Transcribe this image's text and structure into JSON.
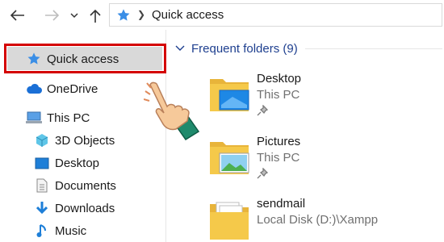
{
  "address_bar": {
    "back_icon": "back-arrow-icon",
    "forward_icon": "forward-arrow-icon",
    "recent_icon": "chevron-down-icon",
    "up_icon": "up-arrow-icon",
    "location_icon": "star-icon",
    "path": "Quick access"
  },
  "nav_pane": {
    "items": [
      {
        "label": "Quick access",
        "icon": "star-icon",
        "selected": true
      },
      {
        "label": "OneDrive",
        "icon": "cloud-icon"
      },
      {
        "label": "This PC",
        "icon": "computer-icon"
      },
      {
        "label": "3D Objects",
        "icon": "cube-icon"
      },
      {
        "label": "Desktop",
        "icon": "desktop-icon"
      },
      {
        "label": "Documents",
        "icon": "document-icon"
      },
      {
        "label": "Downloads",
        "icon": "download-icon"
      },
      {
        "label": "Music",
        "icon": "music-note-icon"
      }
    ]
  },
  "content": {
    "section_title": "Frequent folders (9)",
    "folders": [
      {
        "name": "Desktop",
        "location": "This PC",
        "pinned": true,
        "icon": "folder-desktop-icon"
      },
      {
        "name": "Pictures",
        "location": "This PC",
        "pinned": true,
        "icon": "folder-pictures-icon"
      },
      {
        "name": "sendmail",
        "location": "Local Disk (D:)\\Xampp",
        "pinned": false,
        "icon": "folder-icon"
      }
    ]
  },
  "colors": {
    "accent_blue": "#1e3f8f",
    "selection_border": "#d40000",
    "selection_fill": "#d9d9d9",
    "folder_yellow": "#f5c94a"
  }
}
